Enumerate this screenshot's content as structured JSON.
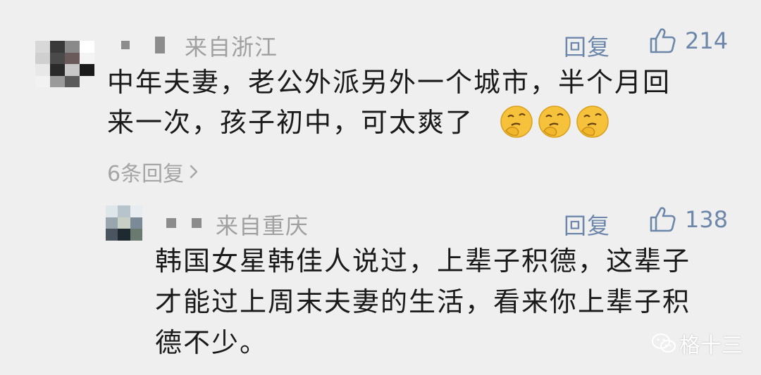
{
  "comment": {
    "user_mask": "■ ▌",
    "source": "来自浙江",
    "reply_label": "回复",
    "like_count": "214",
    "text_lines": [
      "中年夫妻，老公外派另外一个城市，半个月回",
      "来一次，孩子初中，可太爽了"
    ],
    "emoji_icons": [
      "thinking-face-icon",
      "thinking-face-icon",
      "thinking-face-icon"
    ],
    "replies_link": "6条回复"
  },
  "reply": {
    "user_mask": "■ ■",
    "source": "来自重庆",
    "reply_label": "回复",
    "like_count": "138",
    "text_lines": [
      "韩国女星韩佳人说过，上辈子积德，这辈子",
      "才能过上周末夫妻的生活，看来你上辈子积",
      "德不少。"
    ]
  },
  "watermark": {
    "text": "格十三",
    "icon": "wechat-icon"
  },
  "colors": {
    "background": "#efefef",
    "link_blue": "#6d87aa",
    "meta_gray": "#a0a0a0",
    "text": "#1a1a1a"
  }
}
